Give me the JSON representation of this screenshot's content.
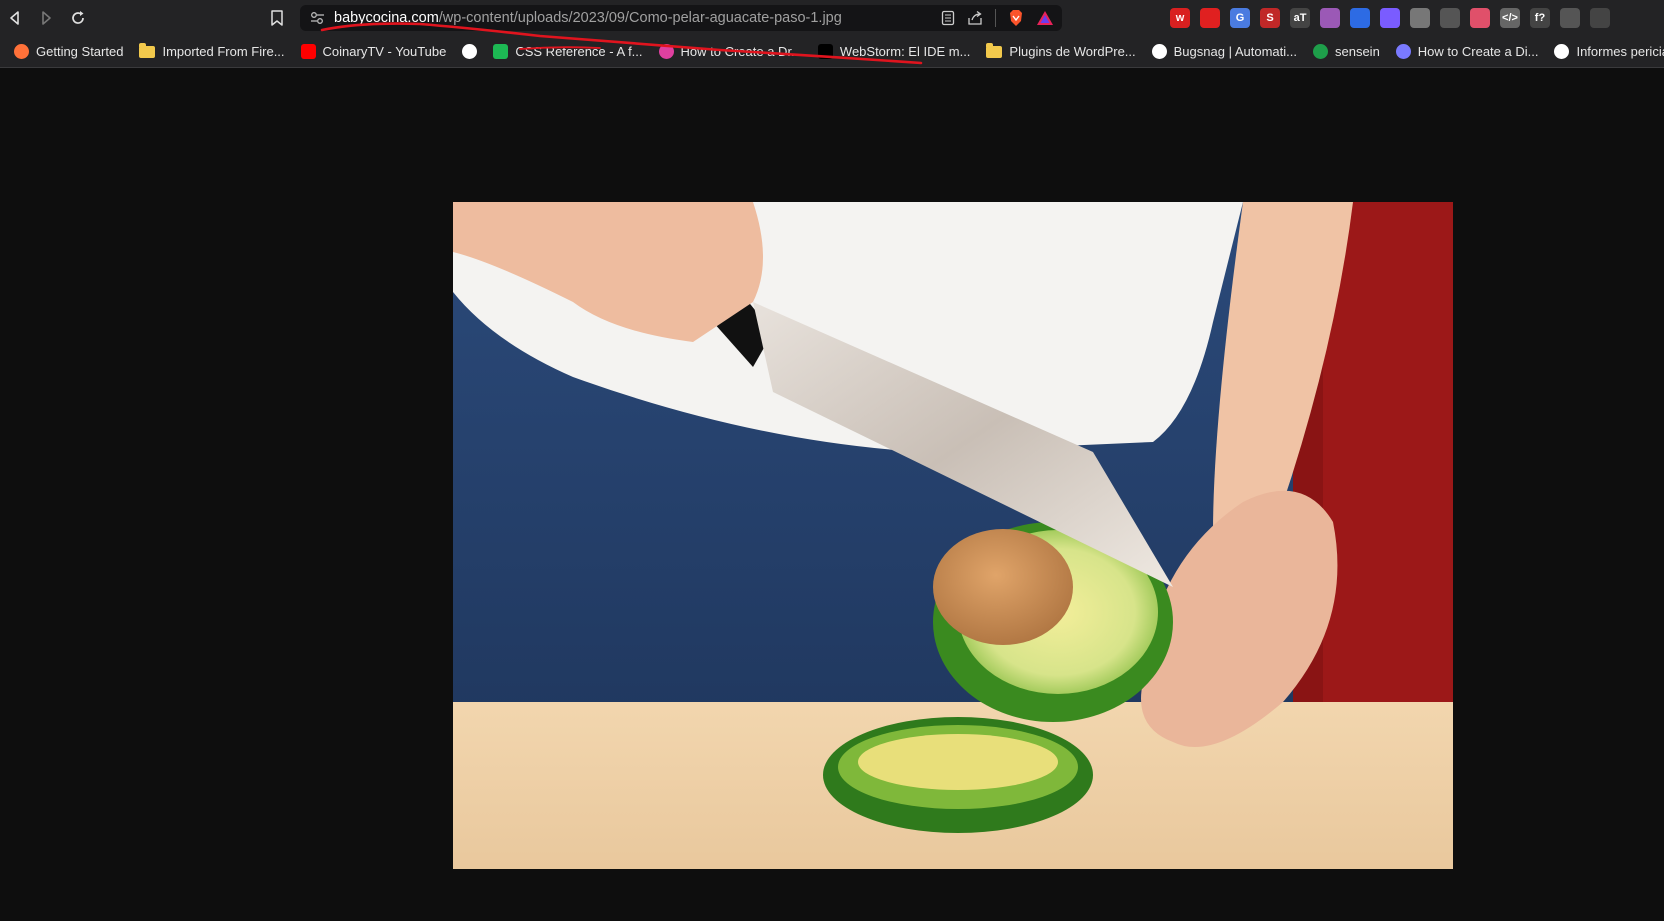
{
  "browser": {
    "url": {
      "domain": "babycocina.com",
      "path": "/wp-content/uploads/2023/09/Como-pelar-aguacate-paso-1.jpg"
    },
    "bookmarks": [
      {
        "label": "Getting Started",
        "icon": "firefox-icon",
        "color": "#ff7139"
      },
      {
        "label": "Imported From Fire...",
        "icon": "folder-icon",
        "color": "#f2c94c"
      },
      {
        "label": "CoinaryTV - YouTube",
        "icon": "youtube-icon",
        "color": "#ff0000"
      },
      {
        "label": "",
        "icon": "globe-icon",
        "color": "#ffffff"
      },
      {
        "label": "CSS Reference - A f...",
        "icon": "play-icon",
        "color": "#1db954"
      },
      {
        "label": "How to Create a Dr...",
        "icon": "star-icon",
        "color": "#e040a0"
      },
      {
        "label": "WebStorm: El IDE m...",
        "icon": "webstorm-icon",
        "color": "#000000"
      },
      {
        "label": "Plugins de WordPre...",
        "icon": "folder-icon",
        "color": "#f2c94c"
      },
      {
        "label": "Bugsnag | Automati...",
        "icon": "bugsnag-icon",
        "color": "#ffffff"
      },
      {
        "label": "sensein",
        "icon": "sensein-icon",
        "color": "#1e9e4a"
      },
      {
        "label": "How to Create a Di...",
        "icon": "spinner-icon",
        "color": "#7a7aff"
      },
      {
        "label": "Informes periciales...",
        "icon": "wordpress-icon",
        "color": "#ffffff"
      }
    ],
    "extensions": [
      {
        "name": "web-ext-icon",
        "text": "w",
        "color": "#d92020"
      },
      {
        "name": "shield-ext-icon",
        "text": "",
        "color": "#e02020"
      },
      {
        "name": "translate-ext-icon",
        "text": "G",
        "color": "#4a7be0"
      },
      {
        "name": "s-ext-icon",
        "text": "S",
        "color": "#c02828"
      },
      {
        "name": "text-ext-icon",
        "text": "aT",
        "color": "#444444"
      },
      {
        "name": "color-ring-ext-icon",
        "text": "",
        "color": "#9b59b6"
      },
      {
        "name": "blue-box-ext-icon",
        "text": "",
        "color": "#2d6be4"
      },
      {
        "name": "gear-ext-icon",
        "text": "",
        "color": "#7a5cff"
      },
      {
        "name": "database-ext-icon",
        "text": "",
        "color": "#777777"
      },
      {
        "name": "circle-ext-icon",
        "text": "",
        "color": "#555555"
      },
      {
        "name": "pink-grid-ext-icon",
        "text": "",
        "color": "#e0506a"
      },
      {
        "name": "code-ext-icon",
        "text": "</>",
        "color": "#666666"
      },
      {
        "name": "function-ext-icon",
        "text": "f?",
        "color": "#444444"
      },
      {
        "name": "window-ext-icon",
        "text": "",
        "color": "#555555"
      },
      {
        "name": "puzzle-ext-icon",
        "text": "",
        "color": "#444444"
      }
    ]
  },
  "colors": {
    "annotation": "#e0141e",
    "page_bg": "#0e0e0e",
    "toolbar_bg": "#232325"
  }
}
